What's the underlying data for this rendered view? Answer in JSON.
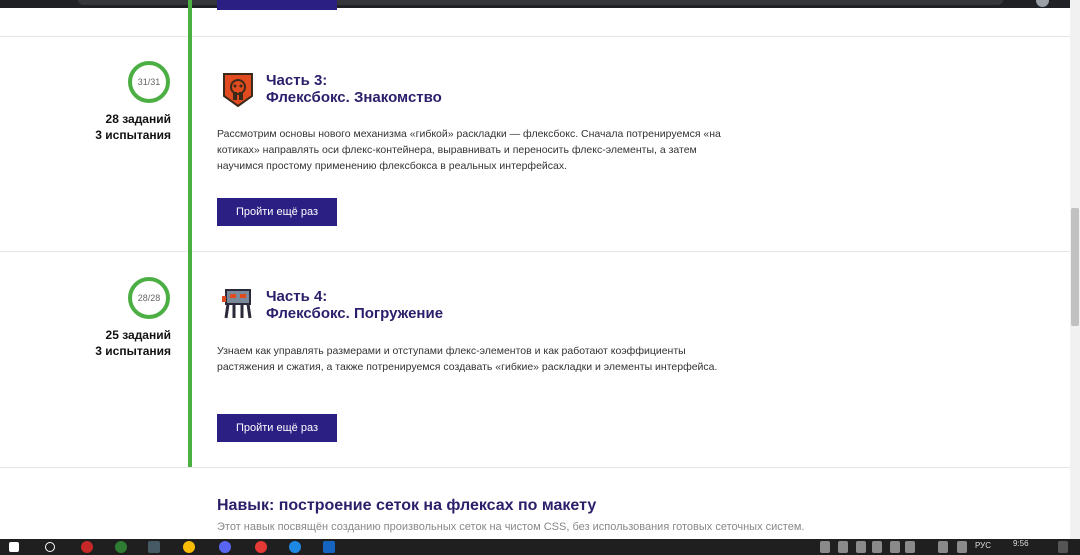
{
  "parts": [
    {
      "progress": "31/31",
      "tasks": "28 заданий",
      "trials": "3 испытания",
      "title_line1": "Часть 3:",
      "title_line2": "Флексбокс. Знакомство",
      "description": "Рассмотрим основы нового механизма «гибкой» раскладки — флексбокс. Сначала потренируемся «на котиках» направлять оси флекс-контейнера, выравнивать и переносить флекс-элементы, а затем научимся простому применению флексбокса в реальных интерфейсах.",
      "button": "Пройти ещё раз",
      "icon": "robot-shield-icon"
    },
    {
      "progress": "28/28",
      "tasks": "25 заданий",
      "trials": "3 испытания",
      "title_line1": "Часть 4:",
      "title_line2": "Флексбокс. Погружение",
      "description": "Узнаем как управлять размерами и отступами флекс-элементов и как работают коэффициенты растяжения и сжатия, а также потренируемся создавать «гибкие» раскладки и элементы интерфейса.",
      "button": "Пройти ещё раз",
      "icon": "walker-robot-icon"
    }
  ],
  "skill": {
    "title": "Навык: построение сеток на флексах по макету",
    "description": "Этот навык посвящён созданию произвольных сеток на чистом CSS, без использования готовых сеточных систем."
  },
  "taskbar": {
    "lang": "РУС",
    "time": "9:56"
  },
  "colors": {
    "accent": "#2b1f84",
    "track": "#4caf43",
    "title": "#2b1f6b"
  }
}
